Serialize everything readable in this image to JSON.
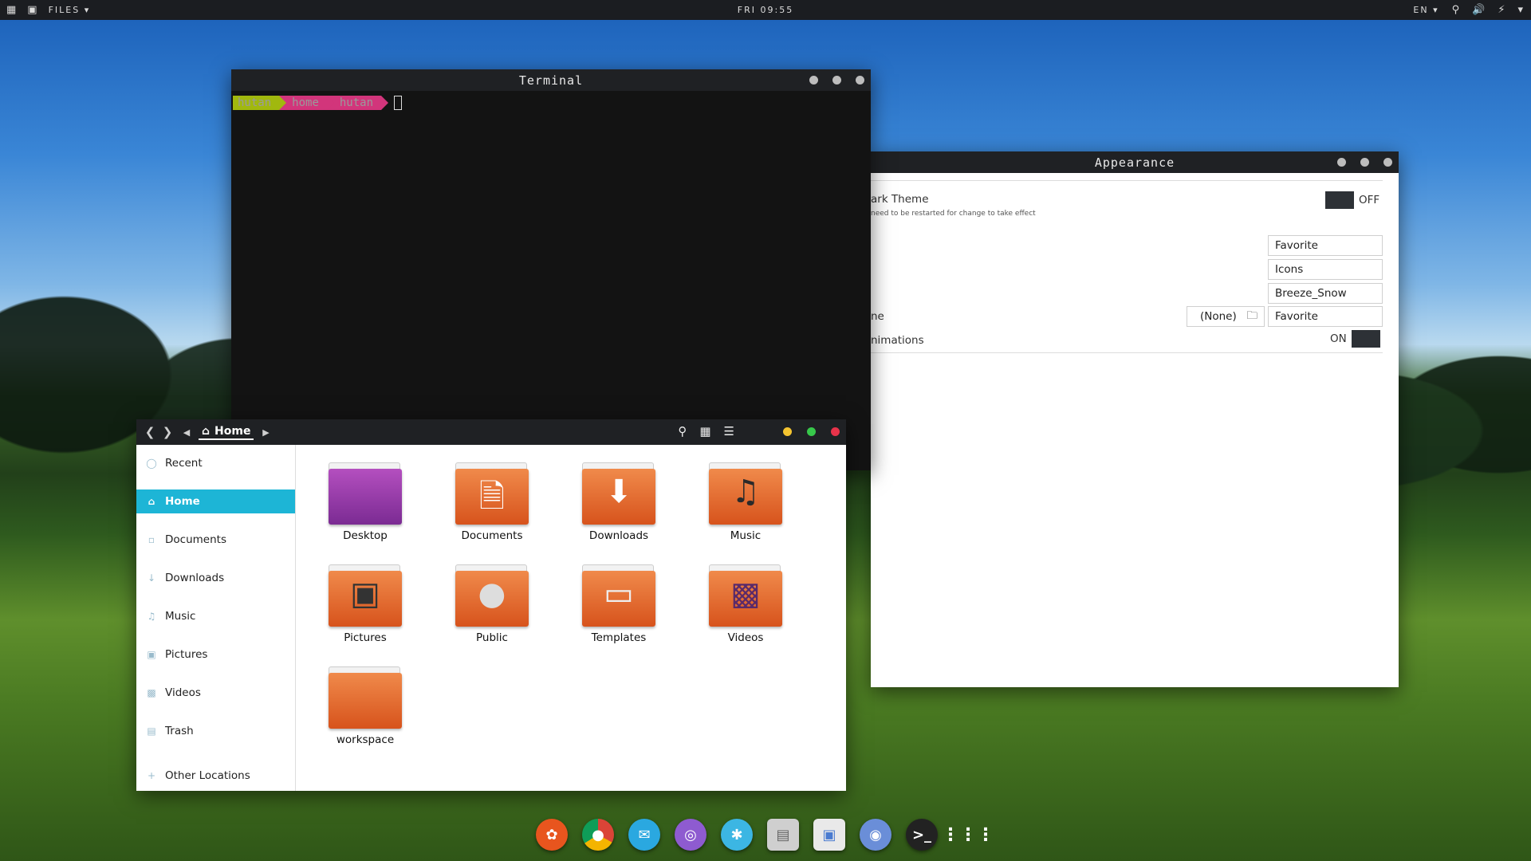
{
  "topbar": {
    "files_label": "FILES",
    "clock": "FRI 09:55",
    "lang": "EN"
  },
  "terminal": {
    "title": "Terminal",
    "prompt": [
      "hutan",
      "home",
      "hutan"
    ]
  },
  "appearance": {
    "title": "Appearance",
    "dark_theme_label": "ark Theme",
    "dark_theme_note": "need to be restarted for change to take effect",
    "dark_theme_state": "OFF",
    "combo1": "Favorite",
    "combo2": "Icons",
    "combo3": "Breeze_Snow",
    "row4_label": "ne",
    "none_button": "(None)",
    "combo4": "Favorite",
    "animations_label": "nimations",
    "animations_state": "ON"
  },
  "files": {
    "breadcrumb": "Home",
    "sidebar": [
      {
        "label": "Recent",
        "icon": "clock-icon"
      },
      {
        "label": "Home",
        "icon": "home-icon"
      },
      {
        "label": "Documents",
        "icon": "document-icon"
      },
      {
        "label": "Downloads",
        "icon": "download-icon"
      },
      {
        "label": "Music",
        "icon": "music-icon"
      },
      {
        "label": "Pictures",
        "icon": "camera-icon"
      },
      {
        "label": "Videos",
        "icon": "video-icon"
      },
      {
        "label": "Trash",
        "icon": "trash-icon"
      },
      {
        "label": "Other Locations",
        "icon": "plus-icon"
      }
    ],
    "folders": [
      "Desktop",
      "Documents",
      "Downloads",
      "Music",
      "Pictures",
      "Public",
      "Templates",
      "Videos",
      "workspace"
    ]
  },
  "colors": {
    "accent": "#1db5d6",
    "folder": "#e86a2e",
    "terminal_bg": "#131313",
    "prompt_green": "#a1b80e",
    "prompt_pink": "#d2357b"
  }
}
